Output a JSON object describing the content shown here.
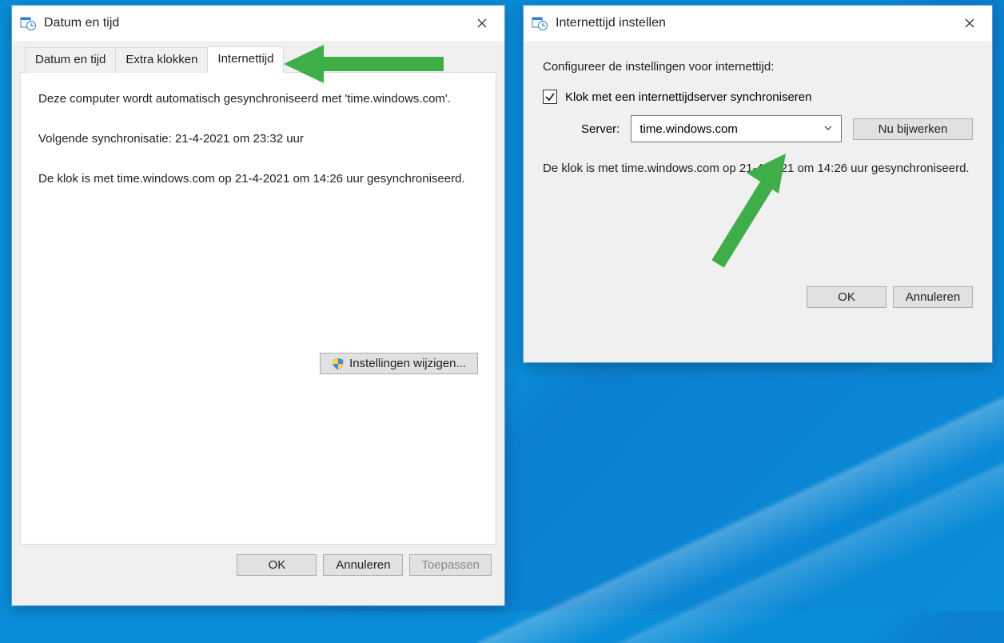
{
  "dialog1": {
    "title": "Datum en tijd",
    "tabs": [
      {
        "label": "Datum en tijd"
      },
      {
        "label": "Extra klokken"
      },
      {
        "label": "Internettijd"
      }
    ],
    "active_tab": 2,
    "content": {
      "sync_info": "Deze computer wordt automatisch gesynchroniseerd met 'time.windows.com'.",
      "next_sync": "Volgende synchronisatie: 21-4-2021 om 23:32 uur",
      "last_sync": "De klok is met time.windows.com op 21-4-2021 om 14:26 uur gesynchroniseerd.",
      "change_settings_btn": "Instellingen wijzigen..."
    },
    "buttons": {
      "ok": "OK",
      "cancel": "Annuleren",
      "apply": "Toepassen"
    }
  },
  "dialog2": {
    "title": "Internettijd instellen",
    "heading": "Configureer de instellingen voor internettijd:",
    "checkbox_label": "Klok met een internettijdserver synchroniseren",
    "checkbox_checked": true,
    "server_label": "Server:",
    "server_value": "time.windows.com",
    "update_btn": "Nu bijwerken",
    "status": "De klok is met time.windows.com op 21-4-2021 om 14:26 uur gesynchroniseerd.",
    "buttons": {
      "ok": "OK",
      "cancel": "Annuleren"
    }
  }
}
